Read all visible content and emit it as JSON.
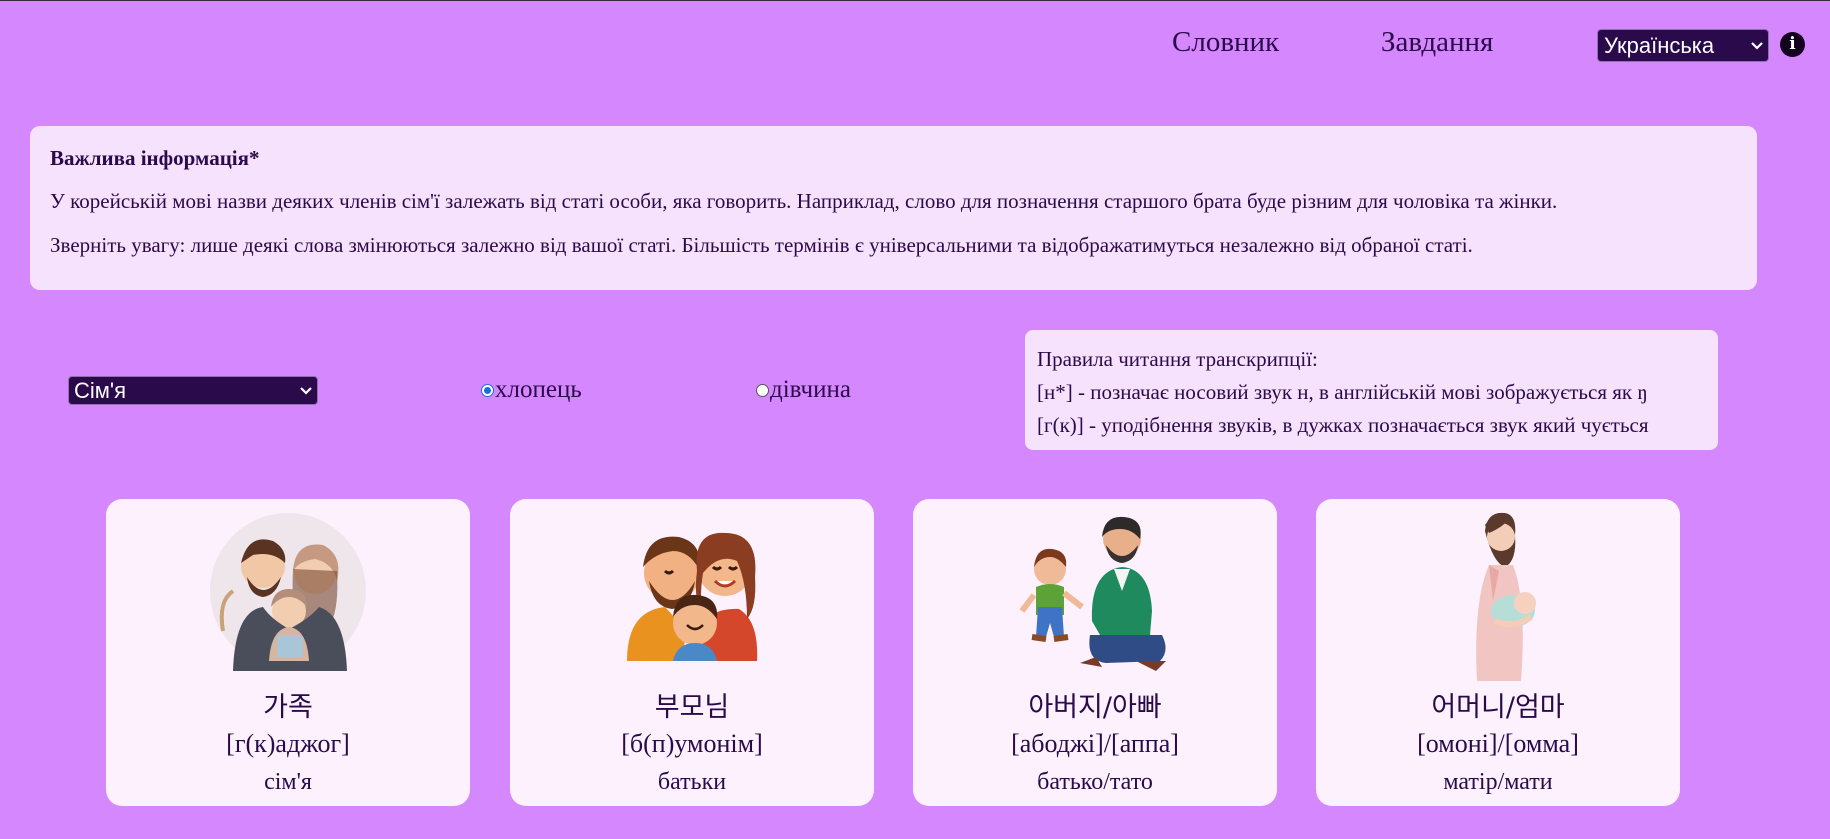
{
  "nav": {
    "dictionary": "Словник",
    "tasks": "Завдання",
    "language": "Українська",
    "info_icon": "info-icon"
  },
  "info": {
    "title": "Важлива інформація*",
    "line1": "У корейській мові назви деяких членів сім'ї залежать від статі особи, яка говорить. Наприклад, слово для позначення старшого брата буде різним для чоловіка та жінки.",
    "line2": "Зверніть увагу: лише деякі слова змінюються залежно від вашої статі. Більшість термінів є універсальними та відображатимуться незалежно від обраної статі."
  },
  "controls": {
    "category": "Сім'я",
    "gender_options": [
      {
        "label": "хлопець",
        "checked": true
      },
      {
        "label": "дівчина",
        "checked": false
      }
    ]
  },
  "rules": {
    "title": "Правила читання транскрипції:",
    "rule1": "[н*] - позначає носовий звук н, в англійській мові зображується як ŋ",
    "rule2": "[г(к)] - уподібнення звуків, в дужках позначається звук який чується"
  },
  "cards": [
    {
      "korean": "가족",
      "transcription": "[г(к)аджог]",
      "translation": "сім'я",
      "image": "family-illustration"
    },
    {
      "korean": "부모님",
      "transcription": "[б(п)умонім]",
      "translation": "батьки",
      "image": "parents-illustration"
    },
    {
      "korean": "아버지/아빠",
      "transcription": "[абоджі]/[аппа]",
      "translation": "батько/тато",
      "image": "father-illustration"
    },
    {
      "korean": "어머니/엄마",
      "transcription": "[омоні]/[омма]",
      "translation": "матір/мати",
      "image": "mother-illustration"
    }
  ],
  "colors": {
    "background": "#d587fd",
    "panel": "#f6e2fd",
    "card": "#fcf1fd",
    "text": "#2a0a4a",
    "select_bg": "#2a0a4a",
    "radio_accent": "#1a6fe0"
  }
}
